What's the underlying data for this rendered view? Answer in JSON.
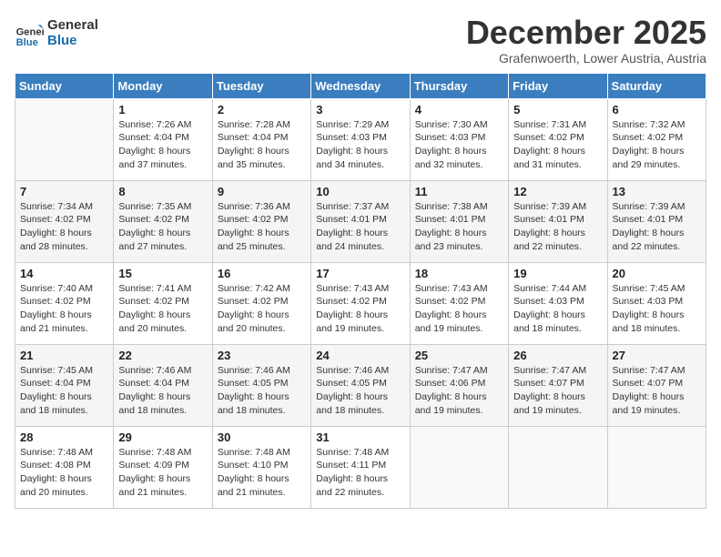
{
  "header": {
    "logo_line1": "General",
    "logo_line2": "Blue",
    "month": "December 2025",
    "location": "Grafenwoerth, Lower Austria, Austria"
  },
  "days_of_week": [
    "Sunday",
    "Monday",
    "Tuesday",
    "Wednesday",
    "Thursday",
    "Friday",
    "Saturday"
  ],
  "weeks": [
    [
      {
        "day": "",
        "sunrise": "",
        "sunset": "",
        "daylight": ""
      },
      {
        "day": "1",
        "sunrise": "7:26 AM",
        "sunset": "4:04 PM",
        "daylight": "8 hours and 37 minutes."
      },
      {
        "day": "2",
        "sunrise": "7:28 AM",
        "sunset": "4:04 PM",
        "daylight": "8 hours and 35 minutes."
      },
      {
        "day": "3",
        "sunrise": "7:29 AM",
        "sunset": "4:03 PM",
        "daylight": "8 hours and 34 minutes."
      },
      {
        "day": "4",
        "sunrise": "7:30 AM",
        "sunset": "4:03 PM",
        "daylight": "8 hours and 32 minutes."
      },
      {
        "day": "5",
        "sunrise": "7:31 AM",
        "sunset": "4:02 PM",
        "daylight": "8 hours and 31 minutes."
      },
      {
        "day": "6",
        "sunrise": "7:32 AM",
        "sunset": "4:02 PM",
        "daylight": "8 hours and 29 minutes."
      }
    ],
    [
      {
        "day": "7",
        "sunrise": "7:34 AM",
        "sunset": "4:02 PM",
        "daylight": "8 hours and 28 minutes."
      },
      {
        "day": "8",
        "sunrise": "7:35 AM",
        "sunset": "4:02 PM",
        "daylight": "8 hours and 27 minutes."
      },
      {
        "day": "9",
        "sunrise": "7:36 AM",
        "sunset": "4:02 PM",
        "daylight": "8 hours and 25 minutes."
      },
      {
        "day": "10",
        "sunrise": "7:37 AM",
        "sunset": "4:01 PM",
        "daylight": "8 hours and 24 minutes."
      },
      {
        "day": "11",
        "sunrise": "7:38 AM",
        "sunset": "4:01 PM",
        "daylight": "8 hours and 23 minutes."
      },
      {
        "day": "12",
        "sunrise": "7:39 AM",
        "sunset": "4:01 PM",
        "daylight": "8 hours and 22 minutes."
      },
      {
        "day": "13",
        "sunrise": "7:39 AM",
        "sunset": "4:01 PM",
        "daylight": "8 hours and 22 minutes."
      }
    ],
    [
      {
        "day": "14",
        "sunrise": "7:40 AM",
        "sunset": "4:02 PM",
        "daylight": "8 hours and 21 minutes."
      },
      {
        "day": "15",
        "sunrise": "7:41 AM",
        "sunset": "4:02 PM",
        "daylight": "8 hours and 20 minutes."
      },
      {
        "day": "16",
        "sunrise": "7:42 AM",
        "sunset": "4:02 PM",
        "daylight": "8 hours and 20 minutes."
      },
      {
        "day": "17",
        "sunrise": "7:43 AM",
        "sunset": "4:02 PM",
        "daylight": "8 hours and 19 minutes."
      },
      {
        "day": "18",
        "sunrise": "7:43 AM",
        "sunset": "4:02 PM",
        "daylight": "8 hours and 19 minutes."
      },
      {
        "day": "19",
        "sunrise": "7:44 AM",
        "sunset": "4:03 PM",
        "daylight": "8 hours and 18 minutes."
      },
      {
        "day": "20",
        "sunrise": "7:45 AM",
        "sunset": "4:03 PM",
        "daylight": "8 hours and 18 minutes."
      }
    ],
    [
      {
        "day": "21",
        "sunrise": "7:45 AM",
        "sunset": "4:04 PM",
        "daylight": "8 hours and 18 minutes."
      },
      {
        "day": "22",
        "sunrise": "7:46 AM",
        "sunset": "4:04 PM",
        "daylight": "8 hours and 18 minutes."
      },
      {
        "day": "23",
        "sunrise": "7:46 AM",
        "sunset": "4:05 PM",
        "daylight": "8 hours and 18 minutes."
      },
      {
        "day": "24",
        "sunrise": "7:46 AM",
        "sunset": "4:05 PM",
        "daylight": "8 hours and 18 minutes."
      },
      {
        "day": "25",
        "sunrise": "7:47 AM",
        "sunset": "4:06 PM",
        "daylight": "8 hours and 19 minutes."
      },
      {
        "day": "26",
        "sunrise": "7:47 AM",
        "sunset": "4:07 PM",
        "daylight": "8 hours and 19 minutes."
      },
      {
        "day": "27",
        "sunrise": "7:47 AM",
        "sunset": "4:07 PM",
        "daylight": "8 hours and 19 minutes."
      }
    ],
    [
      {
        "day": "28",
        "sunrise": "7:48 AM",
        "sunset": "4:08 PM",
        "daylight": "8 hours and 20 minutes."
      },
      {
        "day": "29",
        "sunrise": "7:48 AM",
        "sunset": "4:09 PM",
        "daylight": "8 hours and 21 minutes."
      },
      {
        "day": "30",
        "sunrise": "7:48 AM",
        "sunset": "4:10 PM",
        "daylight": "8 hours and 21 minutes."
      },
      {
        "day": "31",
        "sunrise": "7:48 AM",
        "sunset": "4:11 PM",
        "daylight": "8 hours and 22 minutes."
      },
      {
        "day": "",
        "sunrise": "",
        "sunset": "",
        "daylight": ""
      },
      {
        "day": "",
        "sunrise": "",
        "sunset": "",
        "daylight": ""
      },
      {
        "day": "",
        "sunrise": "",
        "sunset": "",
        "daylight": ""
      }
    ]
  ]
}
